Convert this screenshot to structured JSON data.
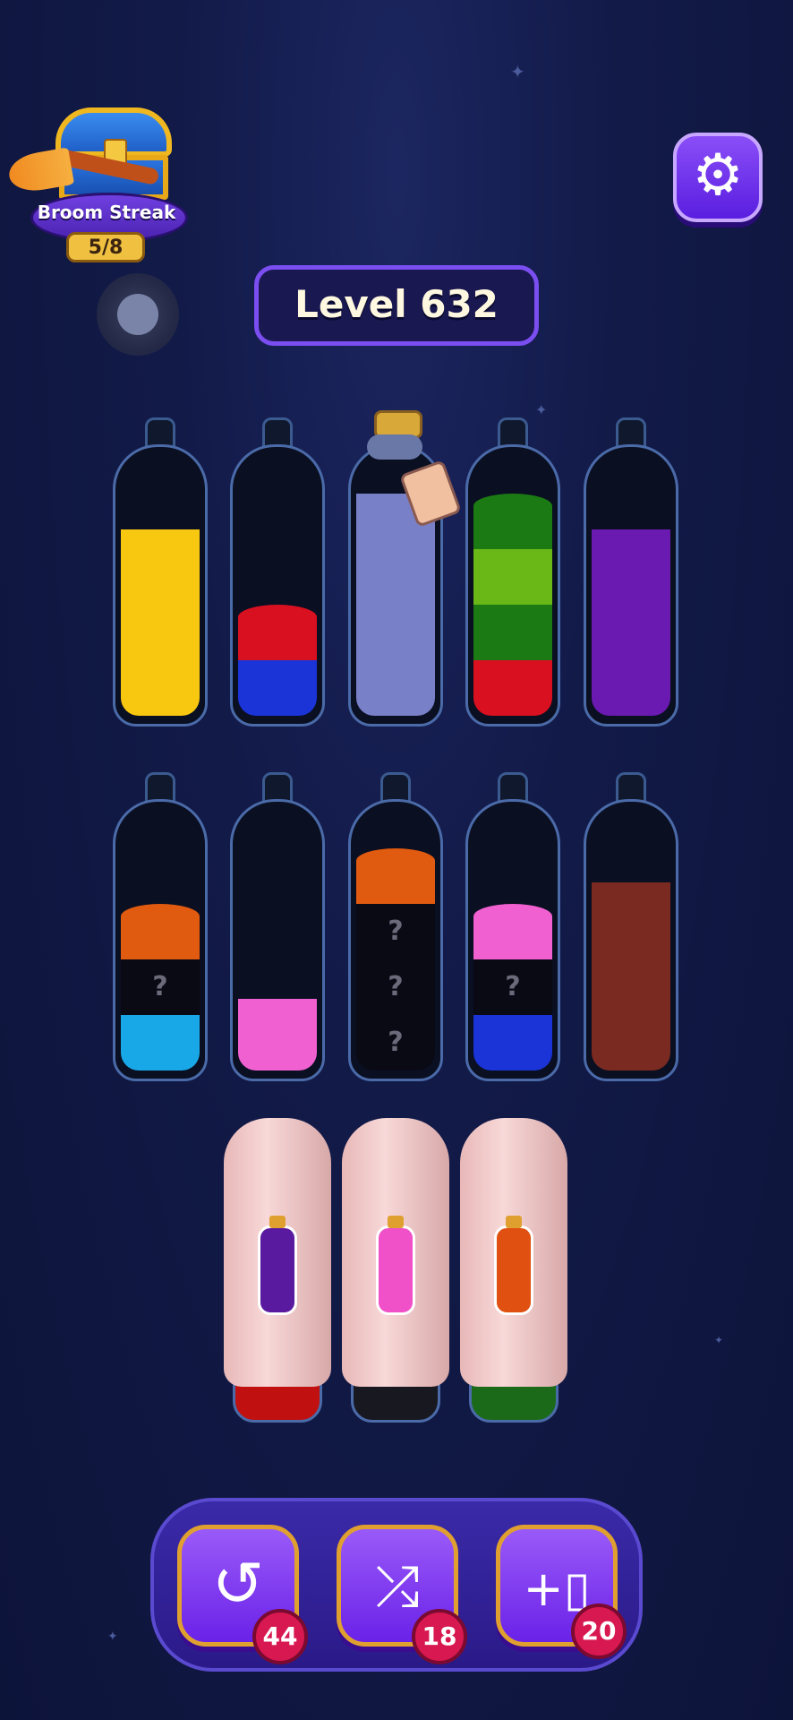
{
  "streak": {
    "label": "Broom Streak",
    "progress": "5/8"
  },
  "level": {
    "label": "Level 632"
  },
  "settings": {
    "icon": "gear-icon"
  },
  "bottles": [
    {
      "id": "b1",
      "layers": [
        "yellow"
      ]
    },
    {
      "id": "b2",
      "layers": [
        "red",
        "blue"
      ]
    },
    {
      "id": "b3",
      "layers": [
        "periwinkle"
      ],
      "corked": true
    },
    {
      "id": "b4",
      "layers": [
        "dark-green",
        "lime",
        "dark-green",
        "red"
      ]
    },
    {
      "id": "b5",
      "layers": [
        "purple"
      ]
    },
    {
      "id": "b6",
      "layers": [
        "orange",
        "hidden",
        "cyan"
      ]
    },
    {
      "id": "b7",
      "layers": [
        "pink"
      ]
    },
    {
      "id": "b8",
      "layers": [
        "orange",
        "hidden",
        "hidden",
        "hidden"
      ]
    },
    {
      "id": "b9",
      "layers": [
        "pink",
        "hidden",
        "blue"
      ]
    },
    {
      "id": "b10",
      "layers": [
        "brown"
      ]
    }
  ],
  "hidden_mark": "?",
  "covered_bottles": [
    {
      "potion_color": "#5a1aa0",
      "base_color": "#c01010"
    },
    {
      "potion_color": "#f050c8",
      "base_color": "#181820"
    },
    {
      "potion_color": "#e05010",
      "base_color": "#1a6a1a"
    }
  ],
  "boosters": [
    {
      "name": "undo",
      "icon": "undo-icon",
      "count": "44"
    },
    {
      "name": "shuffle",
      "icon": "shuffle-icon",
      "count": "18"
    },
    {
      "name": "add-bottle",
      "icon": "add-bottle-icon",
      "count": "20"
    }
  ],
  "colors": {
    "yellow": "#f8c810",
    "red": "#d81020",
    "blue": "#1a34d8",
    "periwinkle": "#7880c8",
    "dark-green": "#1c7a14",
    "lime": "#6ab818",
    "purple": "#6a1ab0",
    "orange": "#e05a10",
    "cyan": "#18a8e8",
    "pink": "#f060d0",
    "brown": "#7a2a20",
    "hidden": "#0a0a14"
  }
}
